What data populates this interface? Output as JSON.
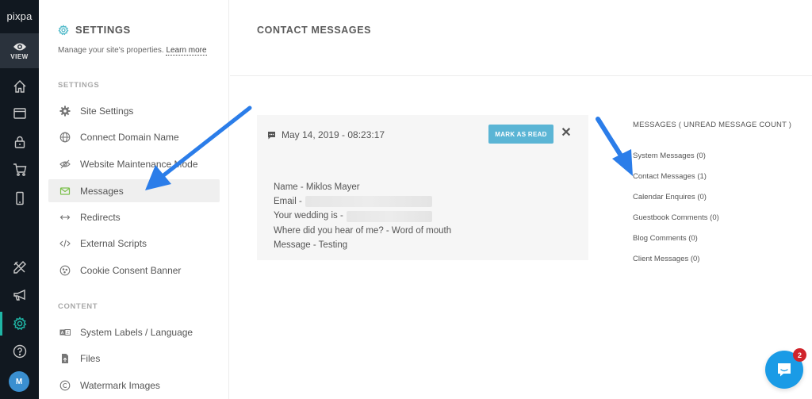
{
  "app": {
    "logo": "pixpa",
    "view_label": "VIEW",
    "avatar_initial": "M",
    "accent_color": "#1fb5a5"
  },
  "rail": {
    "items": [
      {
        "icon": "home-icon"
      },
      {
        "icon": "browser-window-icon"
      },
      {
        "icon": "lock-icon"
      },
      {
        "icon": "cart-icon"
      },
      {
        "icon": "mobile-icon"
      },
      {
        "icon": "design-tools-icon"
      },
      {
        "icon": "megaphone-icon"
      },
      {
        "icon": "gear-icon",
        "active": true
      },
      {
        "icon": "help-icon"
      }
    ]
  },
  "panel": {
    "title": "SETTINGS",
    "description": "Manage your site's properties.",
    "learn_more": "Learn more",
    "sections": [
      {
        "label": "SETTINGS",
        "items": [
          {
            "label": "Site Settings",
            "icon": "gear-icon"
          },
          {
            "label": "Connect Domain Name",
            "icon": "globe-icon"
          },
          {
            "label": "Website Maintenance Mode",
            "icon": "eye-slash-icon"
          },
          {
            "label": "Messages",
            "icon": "envelope-icon",
            "active": true
          },
          {
            "label": "Redirects",
            "icon": "arrows-horizontal-icon"
          },
          {
            "label": "External Scripts",
            "icon": "code-icon"
          },
          {
            "label": "Cookie Consent Banner",
            "icon": "cookie-icon"
          }
        ]
      },
      {
        "label": "CONTENT",
        "items": [
          {
            "label": "System Labels / Language",
            "icon": "language-icon"
          },
          {
            "label": "Files",
            "icon": "file-icon"
          },
          {
            "label": "Watermark Images",
            "icon": "copyright-icon"
          }
        ]
      }
    ]
  },
  "main": {
    "title": "CONTACT MESSAGES",
    "message": {
      "date": "May 14, 2019 - 08:23:17",
      "mark_read_label": "MARK AS READ",
      "close_label": "✕",
      "name_line": "Name - Miklos Mayer",
      "email_label": "Email -",
      "wedding_label": "Your wedding is -",
      "hear_line": "Where did you hear of me? - Word of mouth",
      "message_line": "Message - Testing"
    },
    "list": {
      "header": "MESSAGES ( UNREAD MESSAGE COUNT )",
      "links": [
        "System Messages (0)",
        "Contact Messages (1)",
        "Calendar Enquires (0)",
        "Guestbook Comments (0)",
        "Blog Comments (0)",
        "Client Messages (0)"
      ]
    }
  },
  "chat": {
    "badge_count": "2"
  }
}
